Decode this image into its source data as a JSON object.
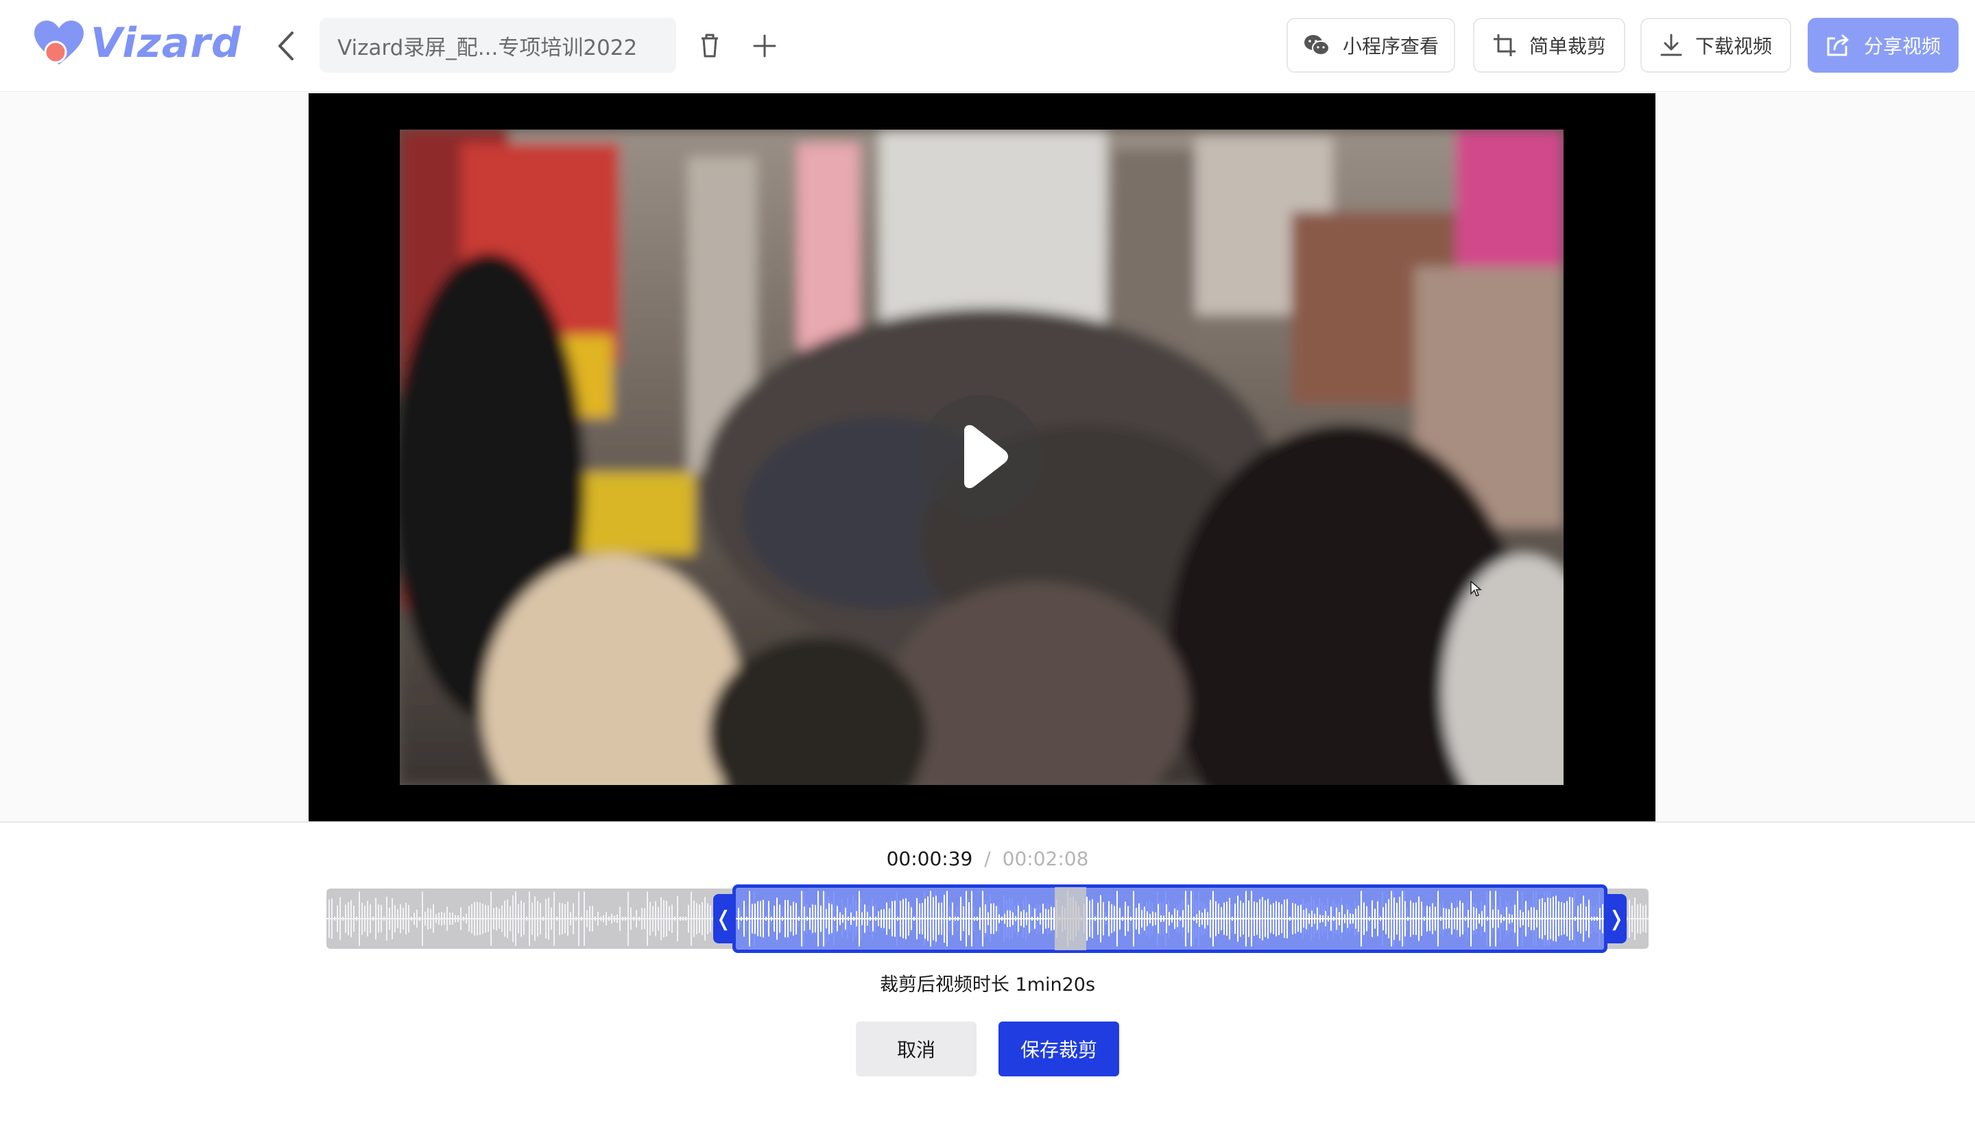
{
  "app": {
    "name": "Vizard"
  },
  "header": {
    "project_title": "Vizard录屏_配...专项培训2022",
    "buttons": {
      "miniprogram": "小程序查看",
      "simple_trim": "简单裁剪",
      "download": "下载视频",
      "share": "分享视频"
    }
  },
  "player": {
    "state": "paused",
    "icons": [
      "play-icon"
    ]
  },
  "trim": {
    "current_time": "00:00:39",
    "separator": "/",
    "total_time": "00:02:08",
    "duration_label": "裁剪后视频时长 1min20s",
    "left_handle": "❬",
    "right_handle": "❭",
    "cancel_label": "取消",
    "save_label": "保存裁剪"
  },
  "colors": {
    "brand": "#7f93f5",
    "share_button": "#8b9ef7",
    "accent": "#1f3de0",
    "selection": "#5e7afa"
  }
}
